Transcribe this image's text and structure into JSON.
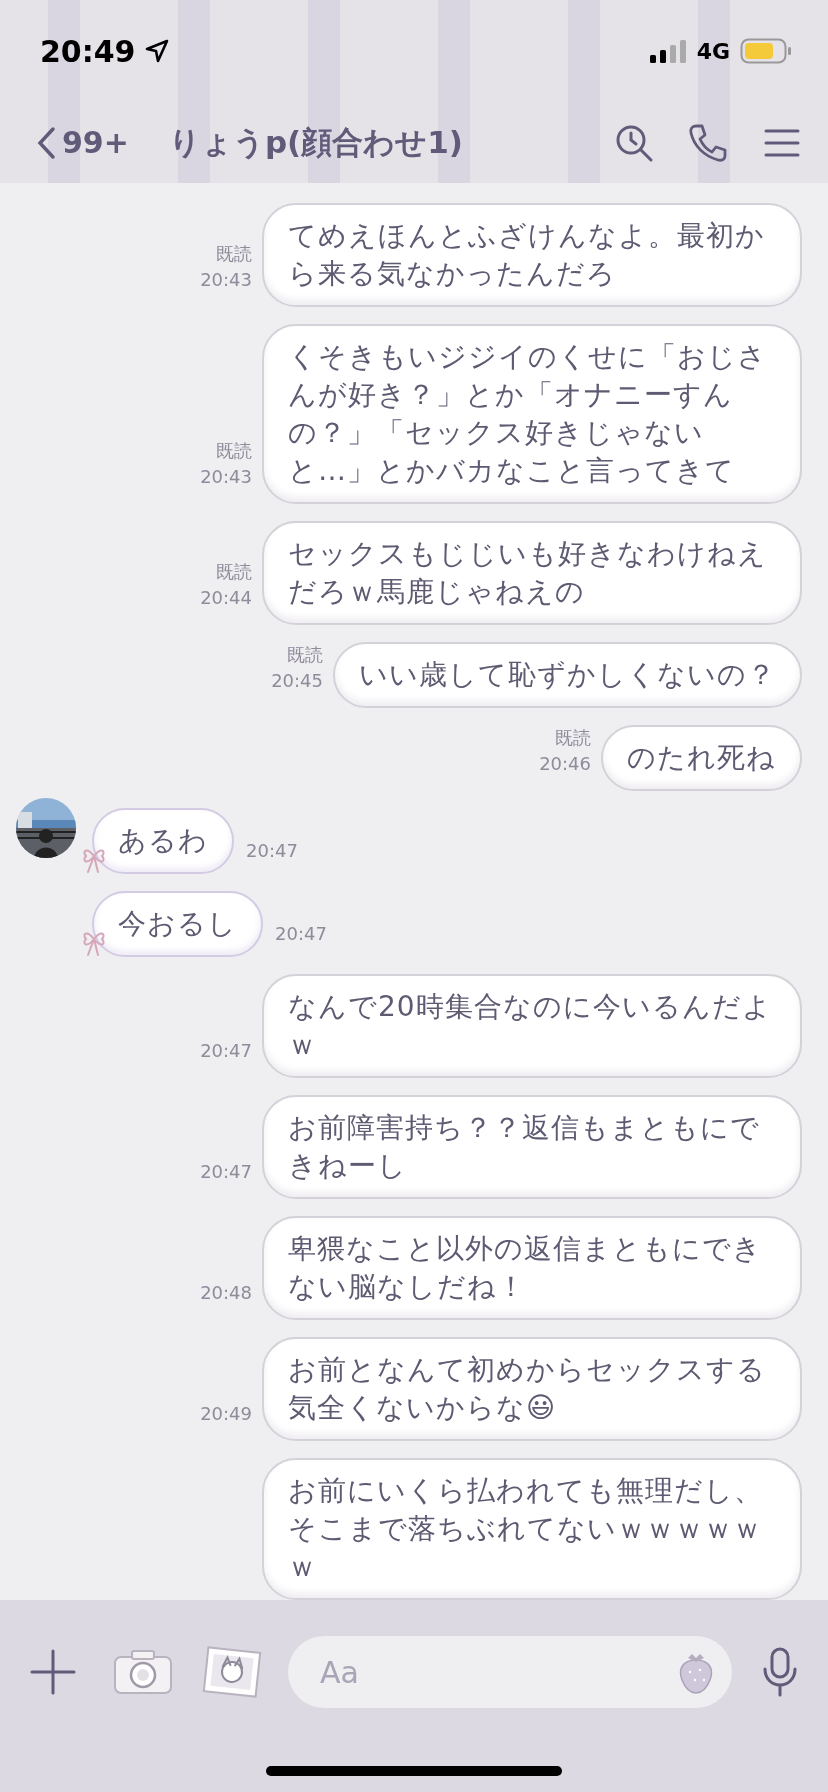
{
  "status_bar": {
    "time": "20:49",
    "network": "4G"
  },
  "header": {
    "back_count": "99+",
    "title": "りょうp(顔合わせ1)"
  },
  "messages": [
    {
      "kind": "sent",
      "read_label": "既読",
      "time": "20:43",
      "text": "てめえほんとふざけんなよ。最初から来る気なかったんだろ"
    },
    {
      "kind": "sent",
      "read_label": "既読",
      "time": "20:43",
      "text": "くそきもいジジイのくせに「おじさんが好き？」とか「オナニーすんの？」「セックス好きじゃないと…」とかバカなこと言ってきて"
    },
    {
      "kind": "sent",
      "read_label": "既読",
      "time": "20:44",
      "text": "セックスもじじいも好きなわけねえだろｗ馬鹿じゃねえの"
    },
    {
      "kind": "sent",
      "read_label": "既読",
      "time": "20:45",
      "text": "いい歳して恥ずかしくないの？"
    },
    {
      "kind": "sent",
      "read_label": "既読",
      "time": "20:46",
      "text": "のたれ死ね"
    },
    {
      "kind": "received",
      "avatar": true,
      "time": "20:47",
      "text": "あるわ"
    },
    {
      "kind": "received",
      "avatar": false,
      "time": "20:47",
      "text": "今おるし"
    },
    {
      "kind": "sent",
      "time": "20:47",
      "text": "なんで20時集合なのに今いるんだよｗ"
    },
    {
      "kind": "sent",
      "time": "20:47",
      "text": "お前障害持ち？？返信もまともにできねーし"
    },
    {
      "kind": "sent",
      "time": "20:48",
      "text": "卑猥なこと以外の返信まともにできない脳なしだね！"
    },
    {
      "kind": "sent",
      "time": "20:49",
      "text": "お前となんて初めからセックスする気全くないからな😃"
    },
    {
      "kind": "sent",
      "text": "お前にいくら払われても無理だし、そこまで落ちぶれてないｗｗｗｗｗｗ"
    }
  ],
  "composer": {
    "placeholder": "Aa"
  }
}
